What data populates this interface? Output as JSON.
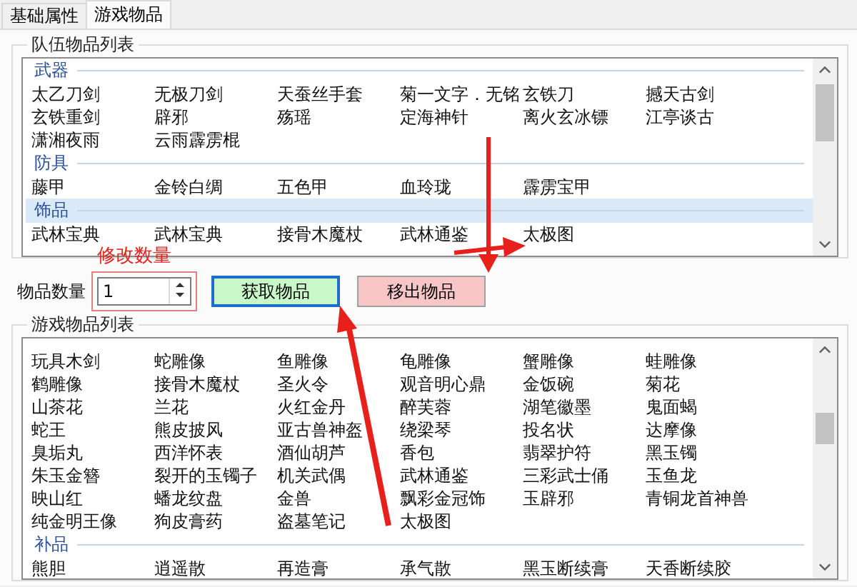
{
  "tabs": [
    {
      "label": "基础属性",
      "selected": false
    },
    {
      "label": "游戏物品",
      "selected": true
    }
  ],
  "team_list": {
    "title": "队伍物品列表",
    "groups": [
      {
        "name": "武器",
        "selected": false,
        "items": [
          "太乙刀剑",
          "无极刀剑",
          "天蚕丝手套",
          "菊一文字．无铭",
          "玄铁刀",
          "撼天古剑",
          "玄铁重剑",
          "辟邪",
          "殇瑶",
          "定海神针",
          "离火玄冰镖",
          "江亭谈古",
          "潇湘夜雨",
          "云雨霹雳棍"
        ]
      },
      {
        "name": "防具",
        "selected": false,
        "items": [
          "藤甲",
          "金铃白绸",
          "五色甲",
          "血玲珑",
          "霹雳宝甲"
        ]
      },
      {
        "name": "饰品",
        "selected": true,
        "items": [
          "武林宝典",
          "武林宝典",
          "接骨木魔杖",
          "武林通鉴",
          "太极图"
        ]
      }
    ]
  },
  "quantity": {
    "label": "物品数量",
    "value": "1"
  },
  "annotation": {
    "text": "修改数量"
  },
  "buttons": [
    {
      "label": "获取物品",
      "kind": "get"
    },
    {
      "label": "移出物品",
      "kind": "remove"
    }
  ],
  "game_list": {
    "title": "游戏物品列表",
    "groups": [
      {
        "selected": false,
        "items": [
          "玩具木剑",
          "蛇雕像",
          "鱼雕像",
          "龟雕像",
          "蟹雕像",
          "蛙雕像",
          "鹤雕像",
          "接骨木魔杖",
          "圣火令",
          "观音明心鼎",
          "金饭碗",
          "菊花",
          "山茶花",
          "兰花",
          "火红金丹",
          "醉芙蓉",
          "湖笔徽墨",
          "鬼面蝎",
          "蛇王",
          "熊皮披风",
          "亚古兽神盔",
          "绕梁琴",
          "投名状",
          "达摩像",
          "臭垢丸",
          "西洋怀表",
          "酒仙胡芦",
          "香包",
          "翡翠护符",
          "黑玉镯",
          "朱玉金簪",
          "裂开的玉镯子",
          "机关武偶",
          "武林通鉴",
          "三彩武士俑",
          "玉鱼龙",
          "映山红",
          "蟠龙纹盘",
          "金兽",
          "飘彩金冠饰",
          "玉辟邪",
          "青铜龙首神兽",
          "纯金明王像",
          "狗皮膏药",
          "盗墓笔记",
          "太极图"
        ]
      },
      {
        "name": "补品",
        "selected": false,
        "items": [
          "熊胆",
          "逍遥散",
          "再造膏",
          "承气散",
          "黑玉断续膏",
          "天香断续胶"
        ]
      }
    ]
  }
}
